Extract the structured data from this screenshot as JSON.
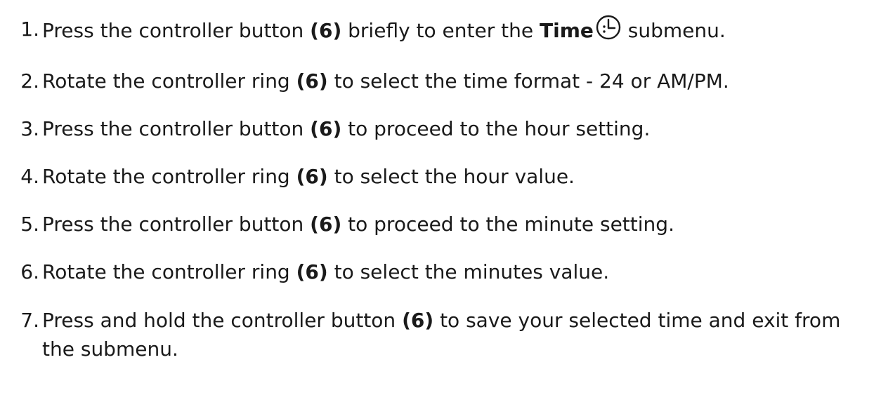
{
  "steps": [
    {
      "number": "1.",
      "text_a": "Press the controller button ",
      "ref": "(6)",
      "text_b": " briefly to enter the ",
      "menu_name": "Time",
      "icon": "clock-icon",
      "text_c": " submenu."
    },
    {
      "number": "2.",
      "text_a": "Rotate the controller ring ",
      "ref": "(6)",
      "text_b": " to select the time format - 24 or AM/PM."
    },
    {
      "number": "3.",
      "text_a": "Press the controller button ",
      "ref": "(6)",
      "text_b": " to proceed to the hour setting."
    },
    {
      "number": "4.",
      "text_a": "Rotate the controller ring ",
      "ref": "(6)",
      "text_b": " to select the hour value."
    },
    {
      "number": "5.",
      "text_a": "Press the controller button ",
      "ref": "(6)",
      "text_b": " to proceed to the minute setting."
    },
    {
      "number": "6.",
      "text_a": "Rotate the controller ring ",
      "ref": "(6)",
      "text_b": " to select the minutes value."
    },
    {
      "number": "7.",
      "text_a": "Press and hold the controller button ",
      "ref": "(6)",
      "text_b": " to save your selected time and exit from the submenu."
    }
  ]
}
